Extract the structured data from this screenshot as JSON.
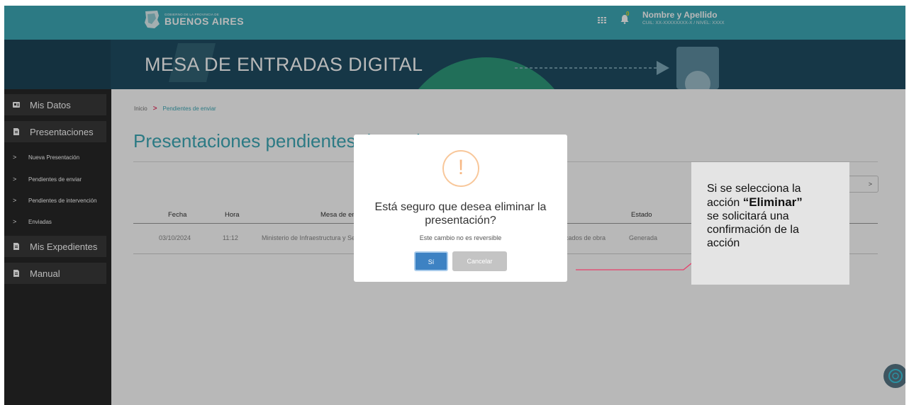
{
  "header": {
    "logo_small": "GOBIERNO DE LA PROVINCIA DE",
    "logo_big": "BUENOS AIRES",
    "notifications_count": "0",
    "user_name": "Nombre y Apellido",
    "user_sub": "CUIL: XX-XXXXXXXX-X / NIVEL: XXXX"
  },
  "banner": {
    "title": "MESA DE ENTRADAS DIGITAL"
  },
  "sidebar": {
    "items": [
      {
        "label": "Mis Datos",
        "icon": "id-card-icon"
      },
      {
        "label": "Presentaciones",
        "icon": "file-icon"
      },
      {
        "label": "Mis Expedientes",
        "icon": "file-icon"
      },
      {
        "label": "Manual",
        "icon": "file-icon"
      }
    ],
    "subitems": [
      {
        "label": "Nueva Presentación"
      },
      {
        "label": "Pendientes de enviar"
      },
      {
        "label": "Pendientes de intervención"
      },
      {
        "label": "Enviadas"
      }
    ]
  },
  "breadcrumb": {
    "home": "Inicio",
    "sep": ">",
    "current": "Pendientes de enviar"
  },
  "page": {
    "title": "Presentaciones pendientes de enviar",
    "action_chevron": ">"
  },
  "table": {
    "headers": {
      "fecha": "Fecha",
      "hora": "Hora",
      "mesa": "Mesa de entrada",
      "estado": "Estado"
    },
    "rows": [
      {
        "fecha": "03/10/2024",
        "hora": "11:12",
        "mesa": "Ministerio de Infraestructura y Servicios Públicos",
        "tramite_tail": "cados de obra",
        "estado": "Generada"
      }
    ]
  },
  "modal": {
    "icon_symbol": "!",
    "question_line1": "Está seguro que desea eliminar la",
    "question_line2": "presentación?",
    "subtitle": "Este cambio no es reversible",
    "confirm_label": "Sí",
    "cancel_label": "Cancelar"
  },
  "callout": {
    "line1": "Si se selecciona la",
    "line2_pre": "acción ",
    "line2_bold": "“Eliminar”",
    "line3": "se solicitará una",
    "line4": "confirmación de la",
    "line5": "acción"
  },
  "colors": {
    "topbar": "#3ea9b7",
    "banner": "#1f4d63",
    "sidebar": "#282828",
    "accent": "#e83e6a",
    "primary_button": "#3d82c3",
    "warning": "#f7b884"
  }
}
